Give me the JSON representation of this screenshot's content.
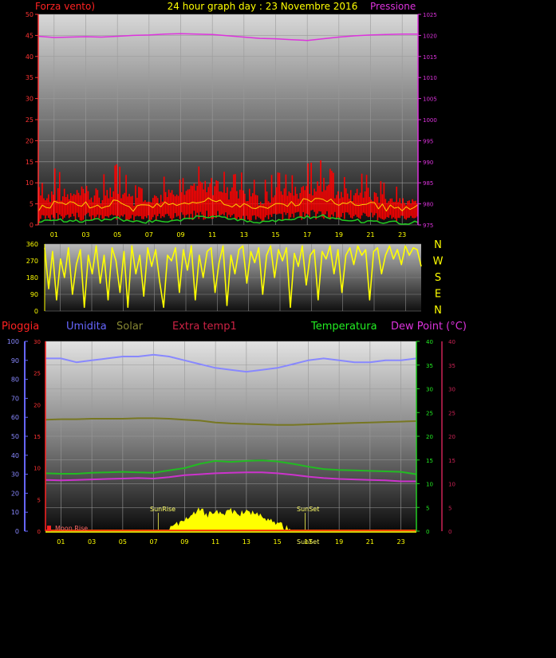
{
  "header": {
    "left_title": "Forza vento)",
    "center_title": "24 hour graph day : 23 Novembre 2016",
    "right_title": "Pressione"
  },
  "labels": {
    "pioggia": "Pioggia",
    "umidita": "Umidita",
    "solar": "Solar",
    "extra_temp": "Extra temp1",
    "temperatura": "Temperatura",
    "dew_point": "Dew Point (°C)",
    "sunrise": "SunRise",
    "sunset": "SunSet",
    "moonrise": "Moon Rise",
    "sunset_bottom": "SunSet"
  },
  "colors": {
    "wind": "#ff0000",
    "wind_green": "#22cc22",
    "pressure": "#dd33dd",
    "direction": "#ffff00",
    "humidity": "#8888ff",
    "solar": "#777722",
    "temperature": "#22bb22",
    "dew": "#cc33cc",
    "sun": "#ffff00",
    "rain_axis": "#ff2222",
    "humidity_axis": "#6666ff"
  },
  "chart_data": [
    {
      "type": "line",
      "name": "wind-pressure",
      "x_ticks": [
        "01",
        "03",
        "05",
        "07",
        "09",
        "11",
        "13",
        "15",
        "17",
        "19",
        "21",
        "23"
      ],
      "y_left_ticks": [
        "0",
        "5",
        "10",
        "15",
        "20",
        "25",
        "30",
        "35",
        "40",
        "45",
        "50"
      ],
      "y_right_ticks": [
        "975",
        "980",
        "985",
        "990",
        "995",
        "1000",
        "1005",
        "1010",
        "1015",
        "1020",
        "1025"
      ],
      "ylim_left": [
        0,
        50
      ],
      "ylim_right": [
        975,
        1025
      ],
      "xlim": [
        0,
        24
      ],
      "pressure": {
        "x": [
          0,
          1,
          2,
          3,
          4,
          5,
          6,
          7,
          8,
          9,
          10,
          11,
          12,
          13,
          14,
          15,
          16,
          17,
          18,
          19,
          20,
          21,
          22,
          23,
          24
        ],
        "values": [
          1019.8,
          1019.5,
          1019.6,
          1019.7,
          1019.6,
          1019.8,
          1020.0,
          1020.1,
          1020.3,
          1020.4,
          1020.3,
          1020.2,
          1019.9,
          1019.6,
          1019.3,
          1019.2,
          1019.0,
          1018.8,
          1019.2,
          1019.6,
          1019.9,
          1020.1,
          1020.2,
          1020.3,
          1020.3
        ]
      },
      "wind_max": {
        "x": [
          0,
          1,
          2,
          3,
          4,
          5,
          6,
          7,
          8,
          9,
          10,
          11,
          12,
          13,
          14,
          15,
          16,
          17,
          18,
          19,
          20,
          21,
          22,
          23,
          24
        ],
        "values": [
          9,
          14,
          11,
          13,
          12,
          15,
          10,
          8,
          12,
          11,
          14,
          16,
          12,
          13,
          10,
          13,
          12,
          15,
          16,
          11,
          13,
          12,
          10,
          9,
          9
        ]
      },
      "wind_avg": {
        "x": [
          0,
          1,
          2,
          3,
          4,
          5,
          6,
          7,
          8,
          9,
          10,
          11,
          12,
          13,
          14,
          15,
          16,
          17,
          18,
          19,
          20,
          21,
          22,
          23,
          24
        ],
        "values": [
          4,
          5,
          5,
          5,
          4,
          6,
          4,
          4,
          5,
          5,
          6,
          6,
          5,
          5,
          4,
          5,
          5,
          6,
          6,
          5,
          5,
          5,
          4,
          4,
          4
        ]
      },
      "wind_green": {
        "x": [
          0,
          1,
          2,
          3,
          4,
          5,
          6,
          7,
          8,
          9,
          10,
          11,
          12,
          13,
          14,
          15,
          16,
          17,
          18,
          19,
          20,
          21,
          22,
          23,
          24
        ],
        "values": [
          1.0,
          1.5,
          0.8,
          1.0,
          1.2,
          1.5,
          0.6,
          0.8,
          1.0,
          1.2,
          1.8,
          2.0,
          1.5,
          1.2,
          0.8,
          1.0,
          1.3,
          1.8,
          2.0,
          1.2,
          1.0,
          0.8,
          0.6,
          0.5,
          0.5
        ]
      }
    },
    {
      "type": "line",
      "name": "wind-direction",
      "y_ticks": [
        "0",
        "90",
        "180",
        "270",
        "360"
      ],
      "right_labels": [
        "N",
        "W",
        "S",
        "E",
        "N"
      ],
      "ylim": [
        0,
        360
      ],
      "xlim": [
        0,
        24
      ],
      "values": [
        340,
        120,
        320,
        60,
        280,
        180,
        340,
        90,
        250,
        330,
        20,
        300,
        200,
        350,
        150,
        300,
        60,
        340,
        270,
        100,
        320,
        20,
        350,
        200,
        300,
        80,
        340,
        240,
        330,
        160,
        20,
        300,
        270,
        340,
        100,
        330,
        220,
        350,
        60,
        300,
        180,
        320,
        340,
        100,
        260,
        350,
        30,
        300,
        200,
        330,
        350,
        150,
        320,
        260,
        340,
        90,
        300,
        350,
        180,
        330,
        270,
        340,
        20,
        310,
        240,
        350,
        140,
        300,
        330,
        60,
        320,
        280,
        350,
        200,
        330,
        100,
        300,
        340,
        250,
        350,
        300,
        330,
        60,
        320,
        340,
        200,
        300,
        350,
        280,
        330,
        250,
        350,
        300,
        340,
        330,
        240
      ]
    },
    {
      "type": "line",
      "name": "temperature-humidity",
      "x_ticks": [
        "01",
        "03",
        "05",
        "07",
        "09",
        "11",
        "13",
        "15",
        "17",
        "19",
        "21",
        "23"
      ],
      "y_humidity_ticks": [
        "0",
        "10",
        "20",
        "30",
        "40",
        "50",
        "60",
        "70",
        "80",
        "90",
        "100"
      ],
      "y_rain_ticks": [
        "0",
        "5",
        "10",
        "15",
        "20",
        "25",
        "30"
      ],
      "y_temp_ticks": [
        "0",
        "5",
        "10",
        "15",
        "20",
        "25",
        "30",
        "35",
        "40"
      ],
      "y_dew_ticks": [
        "0",
        "5",
        "10",
        "15",
        "20",
        "25",
        "30",
        "35",
        "40"
      ],
      "ylim_temp": [
        0,
        40
      ],
      "xlim": [
        0,
        24
      ],
      "humidity": {
        "x": [
          0,
          1,
          2,
          3,
          4,
          5,
          6,
          7,
          8,
          9,
          10,
          11,
          12,
          13,
          14,
          15,
          16,
          17,
          18,
          19,
          20,
          21,
          22,
          23,
          24
        ],
        "values": [
          91,
          91,
          89,
          90,
          91,
          92,
          92,
          93,
          92,
          90,
          88,
          86,
          85,
          84,
          85,
          86,
          88,
          90,
          91,
          90,
          89,
          89,
          90,
          90,
          91
        ]
      },
      "solar_line": {
        "x": [
          0,
          1,
          2,
          3,
          4,
          5,
          6,
          7,
          8,
          9,
          10,
          11,
          12,
          13,
          14,
          15,
          16,
          17,
          18,
          19,
          20,
          21,
          22,
          23,
          24
        ],
        "values": [
          23.5,
          23.6,
          23.6,
          23.7,
          23.7,
          23.7,
          23.8,
          23.8,
          23.7,
          23.5,
          23.3,
          22.9,
          22.7,
          22.6,
          22.5,
          22.4,
          22.4,
          22.5,
          22.6,
          22.7,
          22.8,
          22.9,
          23.0,
          23.1,
          23.2
        ]
      },
      "temperature": {
        "x": [
          0,
          1,
          2,
          3,
          4,
          5,
          6,
          7,
          8,
          9,
          10,
          11,
          12,
          13,
          14,
          15,
          16,
          17,
          18,
          19,
          20,
          21,
          22,
          23,
          24
        ],
        "values": [
          12.2,
          12.1,
          12.1,
          12.3,
          12.4,
          12.5,
          12.4,
          12.3,
          12.8,
          13.3,
          14.2,
          14.8,
          14.6,
          14.8,
          14.9,
          14.7,
          14.2,
          13.6,
          13.1,
          12.9,
          12.8,
          12.7,
          12.6,
          12.5,
          12.0
        ]
      },
      "dew_point": {
        "x": [
          0,
          1,
          2,
          3,
          4,
          5,
          6,
          7,
          8,
          9,
          10,
          11,
          12,
          13,
          14,
          15,
          16,
          17,
          18,
          19,
          20,
          21,
          22,
          23,
          24
        ],
        "values": [
          10.8,
          10.7,
          10.8,
          10.9,
          11.0,
          11.1,
          11.2,
          11.1,
          11.4,
          11.8,
          12.0,
          12.2,
          12.3,
          12.4,
          12.4,
          12.2,
          11.9,
          11.5,
          11.2,
          11.0,
          10.9,
          10.8,
          10.7,
          10.5,
          10.5
        ]
      },
      "solar_radiation": {
        "x": [
          7.0,
          7.5,
          8.0,
          8.5,
          9.0,
          9.5,
          10.0,
          10.5,
          11.0,
          11.5,
          12.0,
          12.5,
          13.0,
          13.5,
          14.0,
          14.5,
          15.0,
          15.5,
          16.0
        ],
        "values": [
          0,
          0.4,
          0.8,
          1.6,
          2.4,
          3.5,
          4.5,
          3.5,
          4.0,
          3.8,
          4.2,
          3.6,
          4.6,
          3.8,
          3.0,
          2.5,
          1.8,
          0.8,
          0
        ]
      },
      "sunrise_hour": 7.3,
      "sunset_hour": 16.8
    }
  ]
}
